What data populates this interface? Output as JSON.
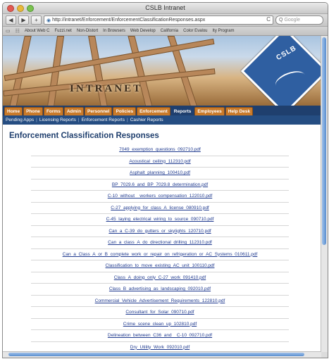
{
  "window": {
    "title": "CSLB Intranet"
  },
  "toolbar": {
    "back": "◀",
    "forward": "▶",
    "add": "+",
    "url": "http://intranet/Enforcement/EnforcementClassificationResponses.aspx",
    "reload": "C",
    "search_placeholder": "Google"
  },
  "bookmarks": [
    "About Web C",
    "Fuzzi.net",
    "Non-Distort",
    "In Browsers",
    "Web Develop",
    "California",
    "Color Evalou",
    "Ity Program"
  ],
  "banner": {
    "word": "INTRANET",
    "logo_text": "CSLB"
  },
  "nav": {
    "tabs": [
      "Home",
      "Phone",
      "Forms",
      "Admin",
      "Personnel",
      "Policies",
      "Enforcement",
      "Reports",
      "Employees",
      "Help Desk"
    ],
    "active": "Reports"
  },
  "subnav": [
    "Pending Apps",
    "Licensing Reports",
    "Enforcement Reports",
    "Cashier Reports"
  ],
  "page": {
    "title": "Enforcement Classification Responses",
    "documents": [
      "7049_exemption_questions_092710.pdf",
      "Acoustical_ceiling_112310.pdf",
      "Asphalt_planning_100410.pdf",
      "BP_7029.6_and_BP_7029.8_determination.pdf",
      "C-10_without__workers_compensation_122010.pdf",
      "C-27_applying_for_class_A_license_080910.pdf",
      "C-45_laying_electrical_wiring_to_source_090710.pdf",
      "Can_a_C-39_do_gutters_or_skylights_120710.pdf",
      "Can_a_class_A_do_directional_drilling_112310.pdf",
      "Can_a_Class_A_or_B_complete_work_or_repair_on_refrigeration_or_AC_Systems_010611.pdf",
      "Classification_to_move_existing_AC_unit_100110.pdf",
      "Class_A_doing_only_C-27_work_091410.pdf",
      "Class_B_advertising_as_landscaping_092010.pdf",
      "Commercial_Vehicle_Advertisement_Requirements_122810.pdf",
      "Consultant_for_Solar_090710.pdf",
      "Crime_scene_clean_up_102810.pdf",
      "Delineation_between_C36_and__C-10_092710.pdf",
      "Dry_Utility_Work_092010.pdf"
    ]
  }
}
